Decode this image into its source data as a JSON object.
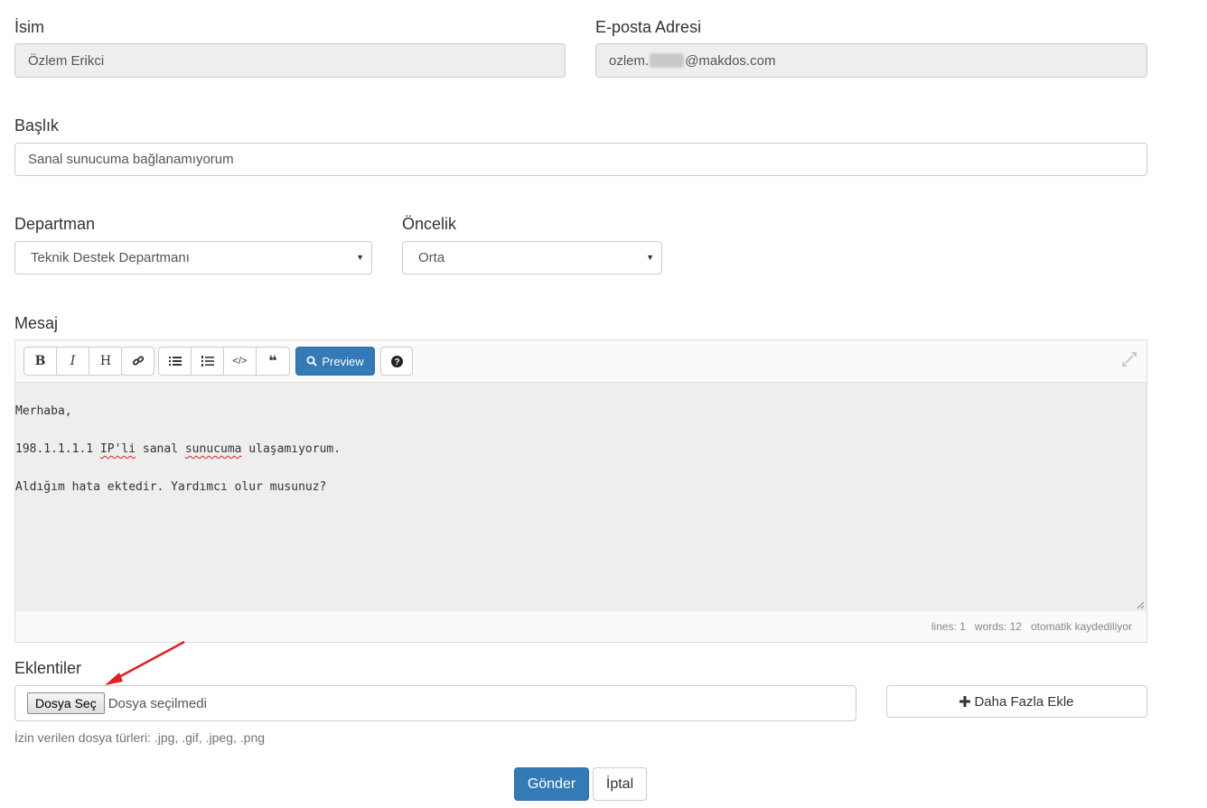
{
  "name_field": {
    "label": "İsim",
    "value": "Özlem Erikci"
  },
  "email_field": {
    "label": "E-posta Adresi",
    "value_prefix": "ozlem.",
    "value_suffix": "@makdos.com"
  },
  "subject_field": {
    "label": "Başlık",
    "value": "Sanal sunucuma bağlanamıyorum"
  },
  "department_field": {
    "label": "Departman",
    "selected": "Teknik Destek Departmanı"
  },
  "priority_field": {
    "label": "Öncelik",
    "selected": "Orta"
  },
  "message": {
    "label": "Mesaj",
    "toolbar": {
      "bold": "B",
      "italic": "I",
      "heading": "H",
      "preview_label": "Preview"
    },
    "line1": "Merhaba,",
    "line2_pre": "198.1.1.1.1 ",
    "line2_word1": "IP'li",
    "line2_mid": " sanal ",
    "line2_word2": "sunucuma",
    "line2_post": " ulaşamıyorum.",
    "line3": "Aldığım hata ektedir. Yardımcı olur musunuz?",
    "status": {
      "lines": "lines: 1",
      "words": "words: 12",
      "autosave": "otomatik kaydediliyor"
    }
  },
  "attachments": {
    "label": "Eklentiler",
    "choose_button": "Dosya Seç",
    "no_file": "Dosya seçilmedi",
    "add_more": "Daha Fazla Ekle",
    "allowed_types": "İzin verilen dosya türleri: .jpg, .gif, .jpeg, .png"
  },
  "actions": {
    "submit": "Gönder",
    "cancel": "İptal"
  },
  "colors": {
    "primary": "#337ab7",
    "annotation_arrow": "#e02020"
  },
  "icons": [
    "link-icon",
    "unordered-list-icon",
    "ordered-list-icon",
    "code-icon",
    "quote-icon",
    "search-icon",
    "question-icon",
    "expand-icon",
    "plus-icon",
    "arrow-annotation-icon"
  ]
}
